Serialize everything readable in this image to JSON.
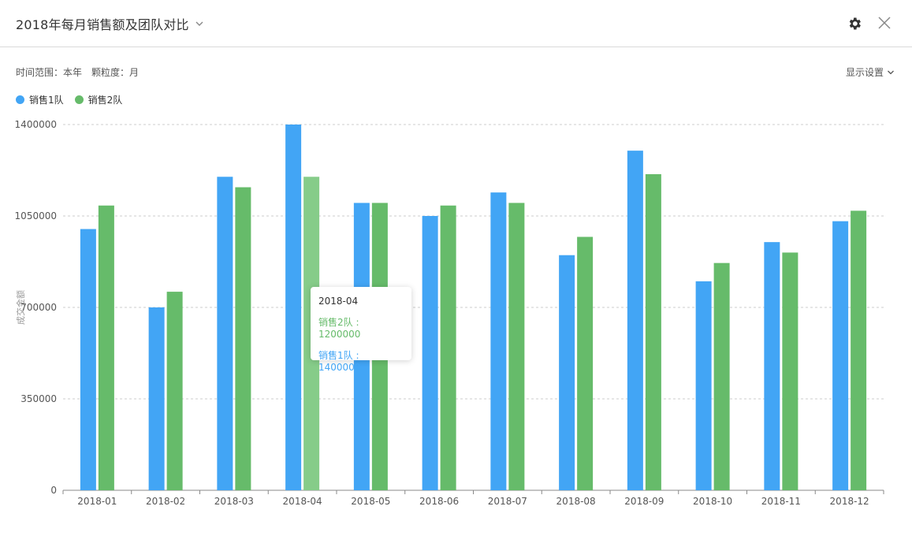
{
  "header": {
    "title": "2018年每月销售额及团队对比",
    "chevron_icon": "chevron-down-icon",
    "settings_icon": "gear-icon",
    "close_icon": "close-icon"
  },
  "filters": {
    "time_range": "时间范围：本年",
    "granularity": "颗粒度：月"
  },
  "display_settings": {
    "label": "显示设置"
  },
  "colors": {
    "team1": "#42a5f5",
    "team2": "#66bb6a",
    "team2_highlight": "#86cc89"
  },
  "tooltip": {
    "title": "2018-04",
    "row1": "销售2队 : 1200000",
    "row2": "销售1队 : 1400000"
  },
  "chart_data": {
    "type": "bar",
    "title": "",
    "xlabel": "",
    "ylabel": "成交金额",
    "ylim": [
      0,
      1400000
    ],
    "yticks": [
      0,
      350000,
      700000,
      1050000,
      1400000
    ],
    "grid": true,
    "legend_position": "top-left",
    "categories": [
      "2018-01",
      "2018-02",
      "2018-03",
      "2018-04",
      "2018-05",
      "2018-06",
      "2018-07",
      "2018-08",
      "2018-09",
      "2018-10",
      "2018-11",
      "2018-12"
    ],
    "series": [
      {
        "name": "销售1队",
        "color": "#42a5f5",
        "values": [
          1000000,
          700000,
          1200000,
          1400000,
          1100000,
          1050000,
          1140000,
          900000,
          1300000,
          800000,
          950000,
          1030000
        ]
      },
      {
        "name": "销售2队",
        "color": "#66bb6a",
        "values": [
          1090000,
          760000,
          1160000,
          1200000,
          1100000,
          1090000,
          1100000,
          970000,
          1210000,
          870000,
          910000,
          1070000
        ]
      }
    ],
    "highlighted_category": "2018-04"
  }
}
